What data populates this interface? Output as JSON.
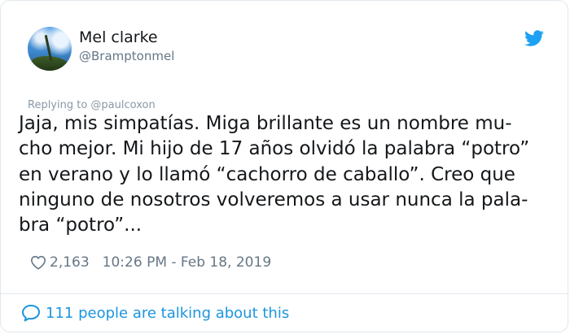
{
  "user": {
    "name": "Mel clarke",
    "handle": "@Bramptonmel"
  },
  "reply_to": "Replying to @paulcoxon",
  "tweet": {
    "lines": [
      "Jaja, mis simpatías. Miga brillante es un nombre mu-",
      "cho mejor. Mi hijo de 17 años olvidó la palabra “potro”",
      "en verano y lo llamó “cachorro de caballo”. Creo que",
      "ninguno de nosotros volveremos a usar nunca la pala-",
      "bra “potro”..."
    ]
  },
  "meta": {
    "likes": "2,163",
    "timestamp": "10:26 PM - Feb 18, 2019"
  },
  "footer": {
    "talking": "111 people are talking about this"
  },
  "icons": {
    "brand": "twitter-bird-icon",
    "like": "heart-outline-icon",
    "comment": "speech-bubble-icon"
  },
  "colors": {
    "accent": "#1da1f2",
    "link": "#1b95e0",
    "muted": "#657786",
    "text": "#14171a",
    "border": "#e1e8ed"
  }
}
